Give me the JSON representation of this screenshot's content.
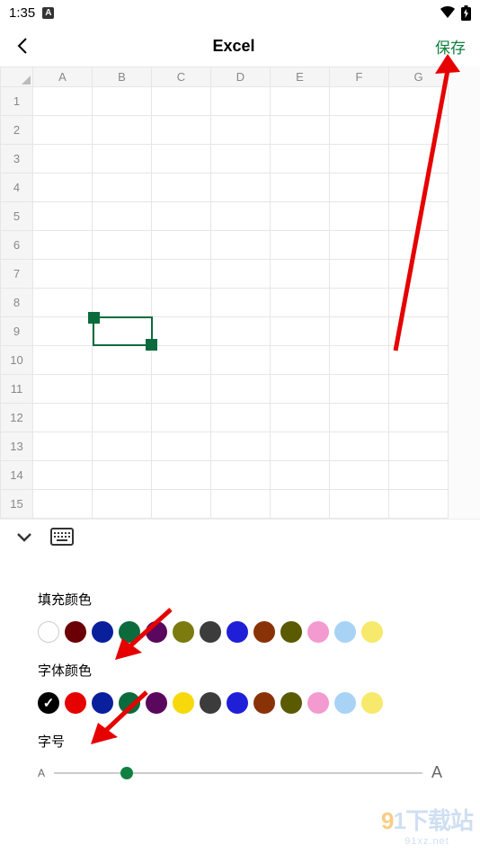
{
  "status": {
    "time": "1:35",
    "indicator": "A"
  },
  "header": {
    "title": "Excel",
    "save_label": "保存"
  },
  "sheet": {
    "columns": [
      "A",
      "B",
      "C",
      "D",
      "E",
      "F",
      "G"
    ],
    "rows": [
      "1",
      "2",
      "3",
      "4",
      "5",
      "6",
      "7",
      "8",
      "9",
      "10",
      "11",
      "12",
      "13",
      "14",
      "15"
    ]
  },
  "panel": {
    "fill_color_title": "填充颜色",
    "fill_colors": [
      "#ffffff",
      "#6a0006",
      "#0a1f9c",
      "#0c6b3d",
      "#5a075e",
      "#7b7b10",
      "#3c3c3c",
      "#1f1fd8",
      "#8a3207",
      "#5a5a00",
      "#f39ad0",
      "#a9d3f5",
      "#f7e96b"
    ],
    "font_color_title": "字体颜色",
    "font_colors": [
      "#000000",
      "#e60000",
      "#0a1f9c",
      "#0c6b3d",
      "#5a075e",
      "#f7d90b",
      "#3c3c3c",
      "#1f1fd8",
      "#8a3207",
      "#5a5a00",
      "#f39ad0",
      "#a9d3f5",
      "#f7e96b"
    ],
    "font_color_selected": 0,
    "font_size_title": "字号",
    "slider_min_label": "A",
    "slider_max_label": "A",
    "slider_value_pct": 18
  },
  "watermark": {
    "nine": "9",
    "one": "1",
    "rest": "下载站",
    "url": "91xz.net"
  }
}
